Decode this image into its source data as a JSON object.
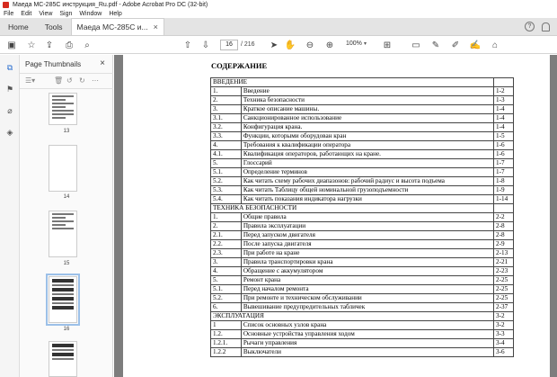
{
  "window": {
    "title": "Маеда МС-285С инструкция_Ru.pdf - Adobe Acrobat Pro DC (32-bit)"
  },
  "menu": [
    "File",
    "Edit",
    "View",
    "Sign",
    "Window",
    "Help"
  ],
  "tabs": {
    "home": "Home",
    "tools": "Tools",
    "document": "Маеда МС-285С и...",
    "close": "×"
  },
  "toolbar": {
    "page_current": "16",
    "page_total": "/ 216",
    "zoom": "100%",
    "zoom_dropdown": "▾"
  },
  "thumbnails_panel": {
    "title": "Page Thumbnails",
    "close": "×",
    "pages": [
      "13",
      "14",
      "15",
      "16"
    ],
    "selected": "16"
  },
  "document": {
    "heading": "СОДЕРЖАНИЕ",
    "rows": [
      {
        "type": "section",
        "name": "ВВЕДЕНИЕ",
        "page": ""
      },
      {
        "num": "1.",
        "title": "Введение",
        "page": "1-2"
      },
      {
        "num": "2.",
        "title": "Техника безопасности",
        "page": "1-3"
      },
      {
        "num": "3.",
        "title": "Краткое описание машины.",
        "page": "1-4"
      },
      {
        "num": "3.1.",
        "title": "Санкционированное использование",
        "page": "1-4"
      },
      {
        "num": "3.2.",
        "title": "Конфигурация крана.",
        "page": "1-4"
      },
      {
        "num": "3.3.",
        "title": "Функции, которыми оборудован кран",
        "page": "1-5"
      },
      {
        "num": "4.",
        "title": "Требования к квалификации оператора",
        "page": "1-6"
      },
      {
        "num": "4.1.",
        "title": "Квалификация операторов, работающих на кране.",
        "page": "1-6"
      },
      {
        "num": "5.",
        "title": "Глоссарий",
        "page": "1-7"
      },
      {
        "num": "5.1.",
        "title": "Определение терминов",
        "page": "1-7"
      },
      {
        "num": "5.2.",
        "title": "Как читать схему рабочих диапазонов: рабочий радиус и высота подъема",
        "page": "1-8"
      },
      {
        "num": "5.3.",
        "title": "Как читать Таблицу общей номинальной грузоподъемности",
        "page": "1-9"
      },
      {
        "num": "5.4.",
        "title": "Как читать показания индикатора нагрузки",
        "page": "1-14"
      },
      {
        "type": "section",
        "name": "ТЕХНИКА БЕЗОПАСНОСТИ",
        "page": ""
      },
      {
        "num": "1.",
        "title": "Общие правила",
        "page": "2-2"
      },
      {
        "num": "2.",
        "title": "Правила эксплуатации",
        "page": "2-8"
      },
      {
        "num": "2.1.",
        "title": "Перед запуском двигателя",
        "page": "2-8"
      },
      {
        "num": "2.2.",
        "title": "После запуска двигателя",
        "page": "2-9"
      },
      {
        "num": "2.3.",
        "title": "При работе на кране",
        "page": "2-13"
      },
      {
        "num": "3.",
        "title": "Правила транспортировки крана",
        "page": "2-21"
      },
      {
        "num": "4.",
        "title": "Обращение с аккумулятором",
        "page": "2-23"
      },
      {
        "num": "5.",
        "title": "Ремонт крана",
        "page": "2-25"
      },
      {
        "num": "5.1.",
        "title": "Перед началом ремонта",
        "page": "2-25"
      },
      {
        "num": "5.2.",
        "title": "При ремонте и техническом обслуживании",
        "page": "2-25"
      },
      {
        "num": "6.",
        "title": "Вывешивание предупредительных табличек",
        "page": "2-37"
      },
      {
        "type": "section",
        "name": "ЭКСПЛУАТАЦИЯ",
        "page": "3-2"
      },
      {
        "num": "1",
        "title": "Список основных узлов крана",
        "page": "3-2"
      },
      {
        "num": "1.2.",
        "title": "Основные устройства управления ходом",
        "page": "3-3"
      },
      {
        "num": "1.2.1.",
        "title": "Рычаги управления",
        "page": "3-4"
      },
      {
        "num": "1.2.2",
        "title": "Выключатели",
        "page": "3-6"
      }
    ]
  }
}
